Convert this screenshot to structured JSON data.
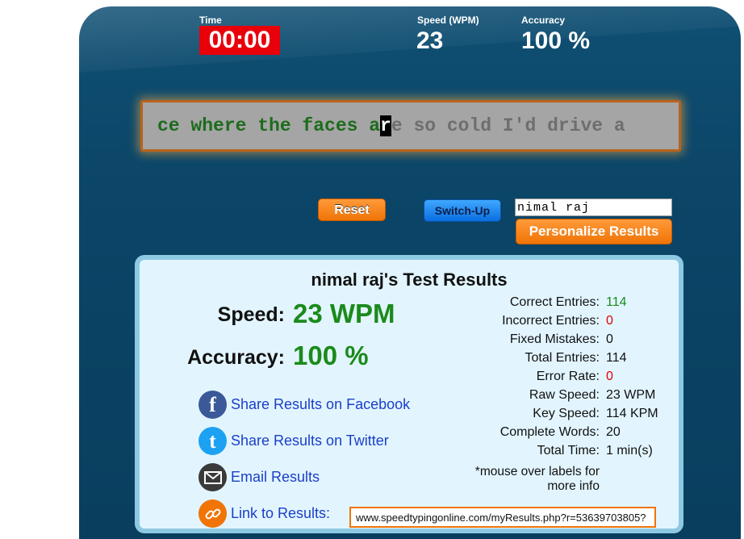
{
  "header": {
    "time_label": "Time",
    "time_value": "00:00",
    "speed_label": "Speed (WPM)",
    "speed_value": "23",
    "accuracy_label": "Accuracy",
    "accuracy_value": "100 %"
  },
  "typing": {
    "typed_text": "ce where the faces a",
    "cursor_char": "r",
    "remaining_text": "e so cold I'd drive a"
  },
  "controls": {
    "reset_label": "Reset",
    "switch_label": "Switch-Up",
    "name_value": "nimal raj",
    "personalize_label": "Personalize Results"
  },
  "results": {
    "title": "nimal raj's Test Results",
    "speed_label": "Speed:",
    "speed_value": "23 WPM",
    "accuracy_label": "Accuracy:",
    "accuracy_value": "100 %",
    "share": {
      "facebook": "Share Results on Facebook",
      "twitter": "Share Results on Twitter",
      "email": "Email Results",
      "link": "Link to Results:"
    },
    "stats": [
      {
        "label": "Correct Entries:",
        "value": "114",
        "color": "#1b8a1b"
      },
      {
        "label": "Incorrect Entries:",
        "value": "0",
        "color": "#e00000"
      },
      {
        "label": "Fixed Mistakes:",
        "value": "0",
        "color": "#111111"
      },
      {
        "label": "Total Entries:",
        "value": "114",
        "color": "#111111"
      },
      {
        "label": "Error Rate:",
        "value": "0",
        "color": "#e00000"
      },
      {
        "label": "Raw Speed:",
        "value": "23 WPM",
        "color": "#111111"
      },
      {
        "label": "Key Speed:",
        "value": "114 KPM",
        "color": "#111111"
      },
      {
        "label": "Complete Words:",
        "value": "20",
        "color": "#111111"
      },
      {
        "label": "Total Time:",
        "value": "1 min(s)",
        "color": "#111111"
      }
    ],
    "note_line1": "*mouse over labels for",
    "note_line2": "more info",
    "link_url": "www.speedtypingonline.com/myResults.php?r=53639703805?"
  },
  "icons": {
    "facebook": "facebook-icon",
    "twitter": "twitter-icon",
    "email": "email-icon",
    "link": "link-icon"
  },
  "colors": {
    "panel": "#0b4567",
    "timer_bg": "#e8000b",
    "accent_orange": "#f07406",
    "accent_blue": "#0a6ee0",
    "results_bg": "#e2f5ff",
    "good_green": "#1b8a1b",
    "link_blue": "#1a3fc8"
  }
}
